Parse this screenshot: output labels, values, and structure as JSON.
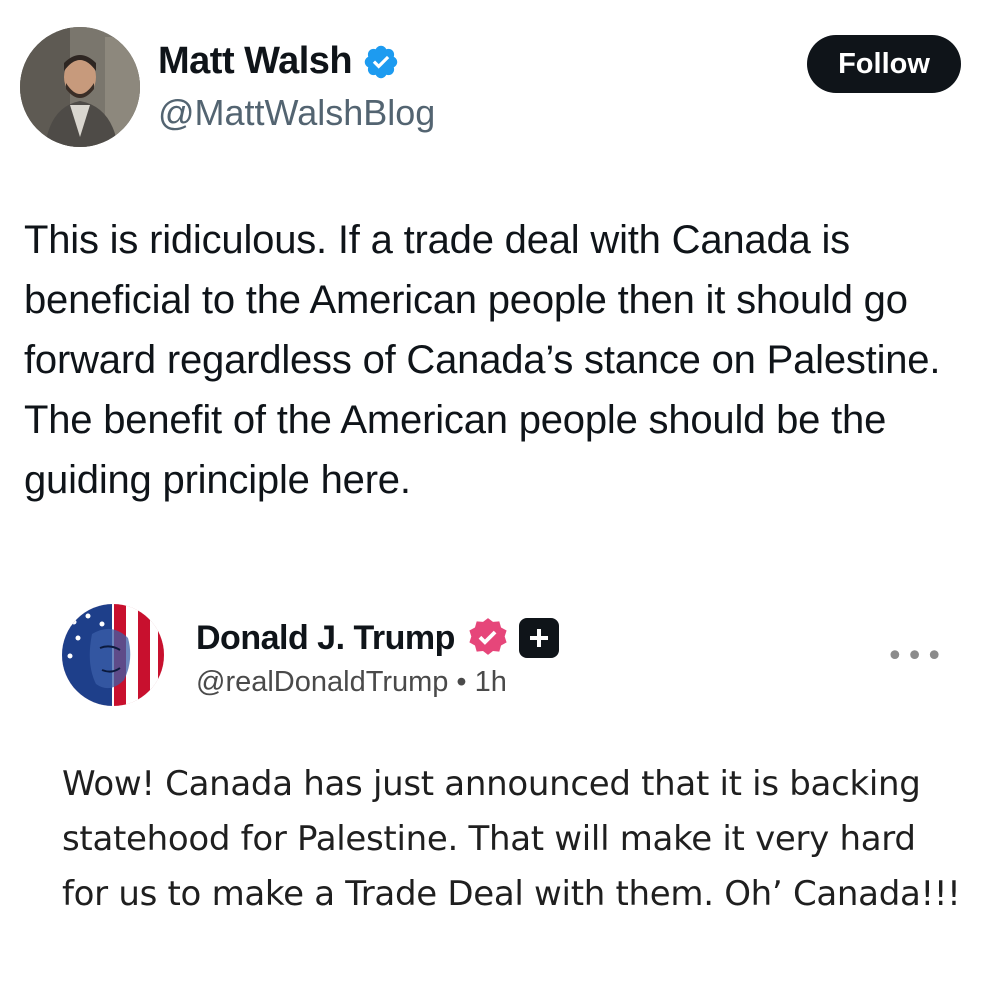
{
  "post": {
    "author_name": "Matt Walsh",
    "author_handle": "@MattWalshBlog",
    "verified_icon": "verified-badge-icon",
    "follow_label": "Follow",
    "text": "This is ridiculous. If a trade deal with Canada is beneficial to the American people then it should go forward regardless of Canada’s stance on Palestine. The benefit of the American people should be the guiding principle here."
  },
  "quoted_post": {
    "author_name": "Donald J. Trump",
    "author_handle": "@realDonaldTrump",
    "separator": "•",
    "time": "1h",
    "more_label": "•••",
    "text": "Wow! Canada has just announced that it is backing statehood for Palestine. That will make it very hard for us to make a Trade Deal with them. Oh’ Canada!!!"
  },
  "colors": {
    "text_primary": "#0f1419",
    "text_secondary": "#536471",
    "verified_blue": "#1d9bf0",
    "verified_pink": "#e6467a",
    "follow_bg": "#0f1419"
  }
}
